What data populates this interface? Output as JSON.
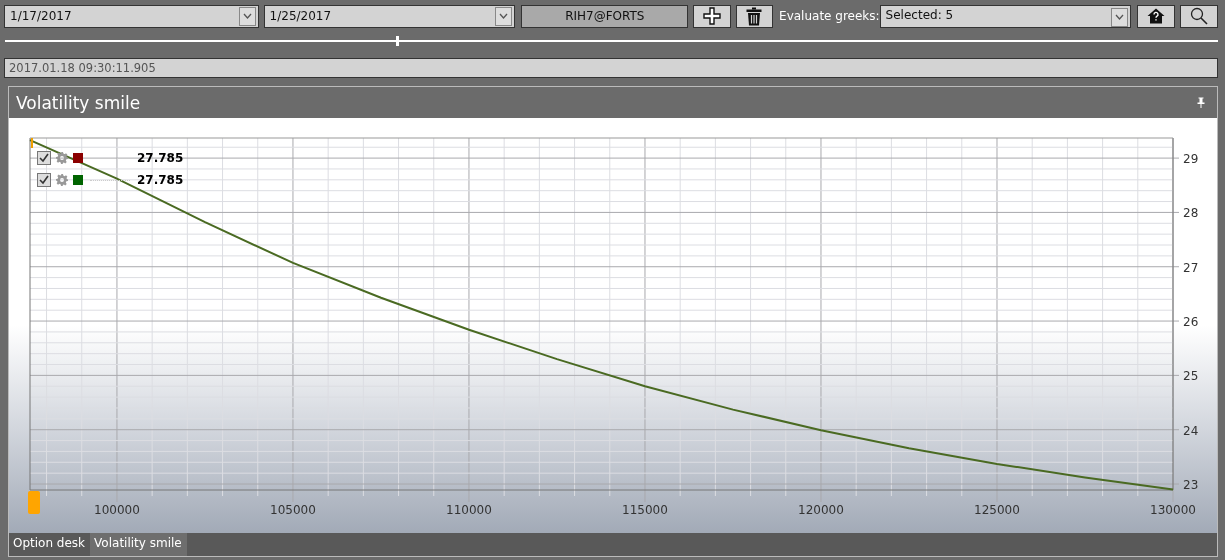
{
  "toolbar": {
    "date_from": "1/17/2017",
    "date_to": "1/25/2017",
    "instrument": "RIH7@FORTS",
    "greeks_label": "Evaluate greeks:",
    "greeks_value": "Selected: 5"
  },
  "time_slider": {
    "level": 0.323
  },
  "timestamp": "2017.01.18 09:30:11.905",
  "panel": {
    "title": "Volatility smile",
    "legend": [
      {
        "checked": true,
        "color": "#8b0000",
        "value": "27.785"
      },
      {
        "checked": true,
        "color": "#006400",
        "value": "27.785"
      }
    ],
    "chart_data": {
      "type": "line",
      "x": [
        97530,
        100000,
        102500,
        105000,
        107500,
        110000,
        112500,
        115000,
        117500,
        120000,
        122500,
        125000,
        127500,
        130000
      ],
      "grid": true,
      "series": [
        {
          "color": "#4a6a22",
          "values": [
            29.33,
            28.62,
            27.82,
            27.07,
            26.43,
            25.84,
            25.3,
            24.8,
            24.37,
            23.99,
            23.66,
            23.37,
            23.12,
            22.9
          ]
        }
      ],
      "xlim": [
        97530,
        130000
      ],
      "ylim": [
        22.89,
        29.37
      ],
      "xticks": [
        100000,
        105000,
        110000,
        115000,
        120000,
        125000,
        130000
      ],
      "yticks": [
        23,
        24,
        25,
        26,
        27,
        28,
        29
      ]
    }
  },
  "tabs": [
    {
      "label": "Option desk",
      "selected": false
    },
    {
      "label": "Volatility smile",
      "selected": true
    }
  ]
}
